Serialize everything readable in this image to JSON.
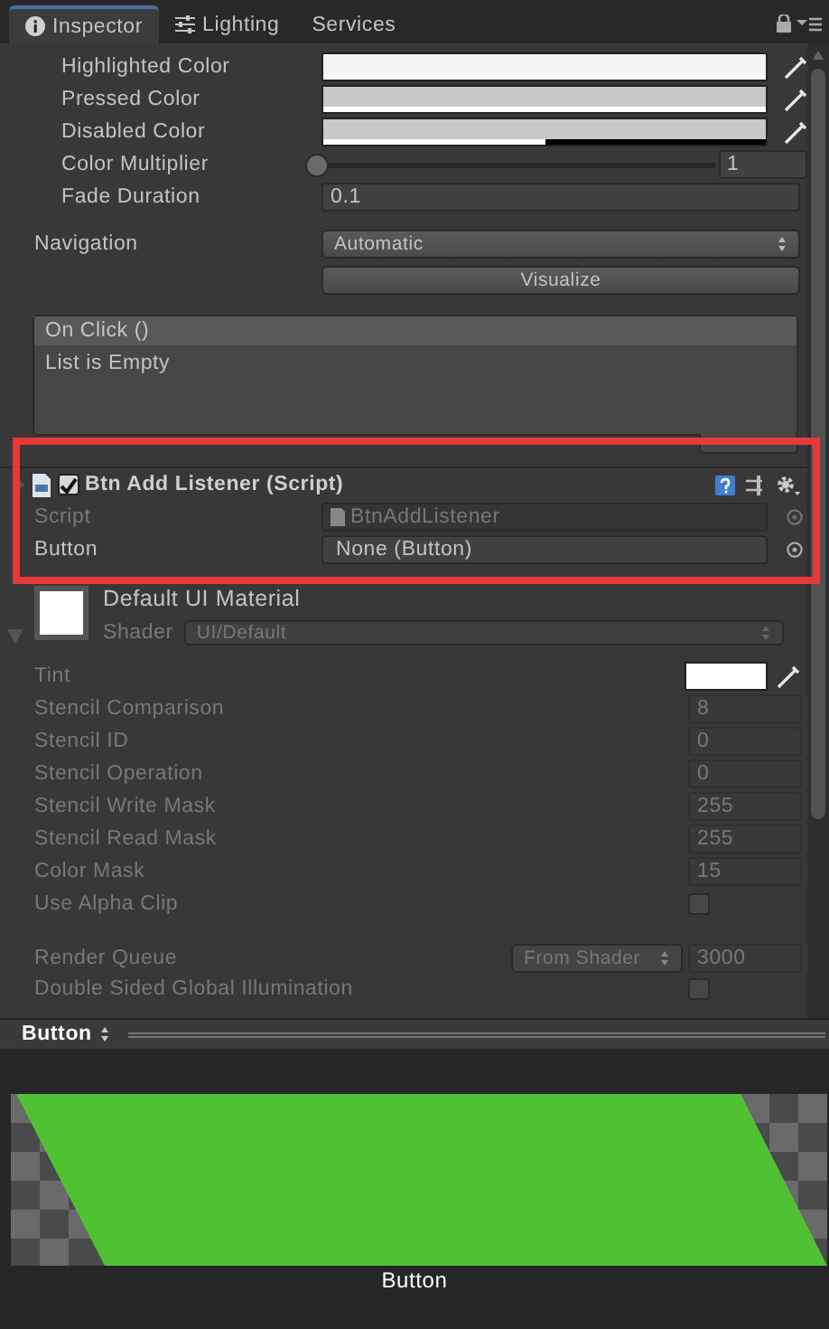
{
  "tabs": [
    {
      "label": "Inspector",
      "selected": true
    },
    {
      "label": "Lighting",
      "selected": false
    },
    {
      "label": "Services",
      "selected": false
    }
  ],
  "button_properties": [
    {
      "kind": "color",
      "label": "Highlighted Color",
      "color": "#f5f5f5",
      "level": 1
    },
    {
      "kind": "color",
      "label": "Pressed Color",
      "color": "#c8c8c8",
      "level": 1
    },
    {
      "kind": "color",
      "label": "Disabled Color",
      "color": "#c8c8c8",
      "level": 0.5
    },
    {
      "kind": "slider",
      "label": "Color Multiplier",
      "level": 0,
      "value": "1"
    },
    {
      "kind": "field",
      "label": "Fade Duration",
      "value": "0.1"
    }
  ],
  "navigation": {
    "label": "Navigation",
    "value": "Automatic",
    "button": "Visualize"
  },
  "on_click": {
    "title": "On Click ()",
    "body": "List is Empty"
  },
  "component": {
    "title": "Btn Add Listener (Script)",
    "enabled": true,
    "fields": [
      {
        "label": "Script",
        "value": "BtnAddListener",
        "disabled": true
      },
      {
        "label": "Button",
        "value": "None (Button)",
        "disabled": false
      }
    ]
  },
  "material": {
    "name": "Default UI Material",
    "shader_label": "Shader",
    "shader": "UI/Default"
  },
  "material_properties": [
    {
      "kind": "color",
      "label": "Tint",
      "color": "#ffffff",
      "disabled": true
    },
    {
      "kind": "field",
      "label": "Stencil Comparison",
      "value": "8",
      "disabled": true
    },
    {
      "kind": "field",
      "label": "Stencil ID",
      "value": "0",
      "disabled": true
    },
    {
      "kind": "field",
      "label": "Stencil Operation",
      "value": "0",
      "disabled": true
    },
    {
      "kind": "field",
      "label": "Stencil Write Mask",
      "value": "255",
      "disabled": true
    },
    {
      "kind": "field",
      "label": "Stencil Read Mask",
      "value": "255",
      "disabled": true
    },
    {
      "kind": "field",
      "label": "Color Mask",
      "value": "15",
      "disabled": true
    },
    {
      "kind": "checkbox",
      "label": "Use Alpha Clip",
      "checked": false,
      "disabled": true
    },
    {
      "kind": "dropdown_field",
      "label": "Render Queue",
      "option": "From Shader",
      "value": "3000",
      "disabled": true
    },
    {
      "kind": "checkbox",
      "label": "Double Sided Global Illumination",
      "checked": false,
      "disabled": true
    }
  ],
  "preview": {
    "title": "Button",
    "caption": "Button"
  }
}
